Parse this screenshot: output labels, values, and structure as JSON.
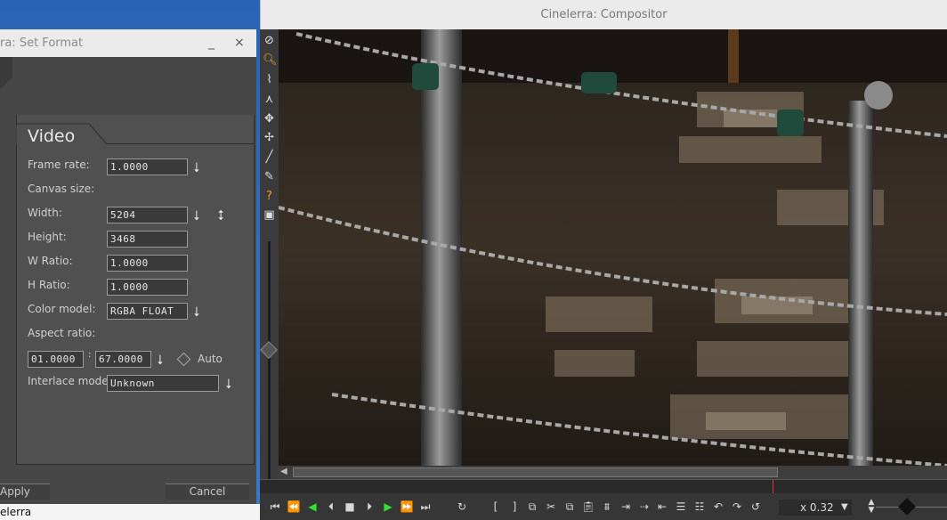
{
  "desktop": {
    "taskbar_label": "elerra"
  },
  "set_format": {
    "title": "ra: Set Format",
    "minimize_label": "_",
    "close_label": "×",
    "tab_label": "Video",
    "labels": {
      "frame_rate": "Frame rate:",
      "canvas_size": "Canvas size:",
      "width": "Width:",
      "height": "Height:",
      "w_ratio": "W Ratio:",
      "h_ratio": "H Ratio:",
      "color_model": "Color model:",
      "aspect_ratio": "Aspect ratio:",
      "interlace_mode": "Interlace mode:",
      "auto": "Auto"
    },
    "values": {
      "frame_rate": "1.0000",
      "width": "5204",
      "height": "3468",
      "w_ratio": "1.0000",
      "h_ratio": "1.0000",
      "color_model": "RGBA FLOAT",
      "aspect_w": "01.0000",
      "aspect_h": "67.0000",
      "interlace_mode": "Unknown"
    },
    "buttons": {
      "apply": "Apply",
      "cancel": "Cancel"
    }
  },
  "compositor": {
    "title": "Cinelerra: Compositor",
    "zoom_label": "x 0.32",
    "tools": [
      "protect-icon",
      "magnify-icon",
      "mask-icon",
      "ruler-icon",
      "camera-icon",
      "projector-icon",
      "crop-icon",
      "eyedropper-icon",
      "help-icon",
      "safe-region-icon"
    ],
    "colors": {
      "accent_green": "#35e035",
      "playhead": "#ff3030"
    }
  }
}
